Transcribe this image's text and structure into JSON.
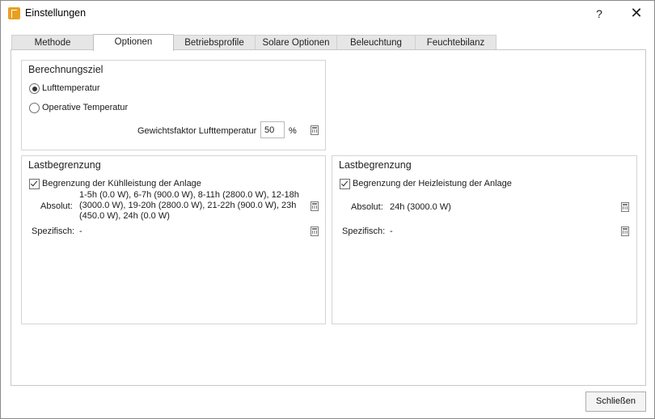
{
  "window": {
    "title": "Einstellungen",
    "help": "?",
    "close": "✕"
  },
  "tabs": [
    {
      "label": "Methode"
    },
    {
      "label": "Optionen"
    },
    {
      "label": "Betriebsprofile"
    },
    {
      "label": "Solare Optionen"
    },
    {
      "label": "Beleuchtung"
    },
    {
      "label": "Feuchtebilanz"
    }
  ],
  "active_tab": "Optionen",
  "berechnungsziel": {
    "title": "Berechnungsziel",
    "option_air": "Lufttemperatur",
    "option_operative": "Operative Temperatur",
    "selected": "Lufttemperatur",
    "weight_label": "Gewichtsfaktor Lufttemperatur",
    "weight_value": "50",
    "weight_unit": "%"
  },
  "cooling": {
    "title": "Lastbegrenzung",
    "checkbox_label": "Begrenzung der Kühlleistung der Anlage",
    "checked": true,
    "absolute_label": "Absolut:",
    "absolute_value": "1-5h (0.0 W), 6-7h (900.0 W), 8-11h (2800.0 W), 12-18h (3000.0 W), 19-20h (2800.0 W), 21-22h (900.0 W), 23h (450.0 W), 24h (0.0 W)",
    "specific_label": "Spezifisch:",
    "specific_value": "-"
  },
  "heating": {
    "title": "Lastbegrenzung",
    "checkbox_label": "Begrenzung der Heizleistung der Anlage",
    "checked": true,
    "absolute_label": "Absolut:",
    "absolute_value": "24h (3000.0 W)",
    "specific_label": "Spezifisch:",
    "specific_value": "-"
  },
  "footer": {
    "close_label": "Schließen"
  }
}
